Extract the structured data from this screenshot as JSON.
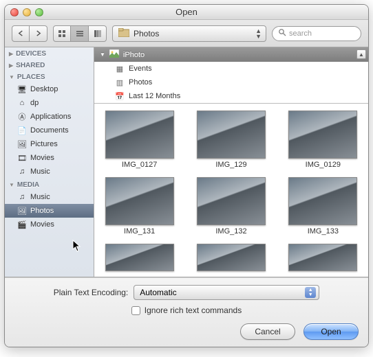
{
  "window": {
    "title": "Open"
  },
  "toolbar": {
    "path_label": "Photos",
    "search_placeholder": "search"
  },
  "sidebar": {
    "sections": {
      "devices": "DEVICES",
      "shared": "SHARED",
      "places": "PLACES",
      "media": "MEDIA"
    },
    "places": [
      {
        "label": "Desktop"
      },
      {
        "label": "dp"
      },
      {
        "label": "Applications"
      },
      {
        "label": "Documents"
      },
      {
        "label": "Pictures"
      },
      {
        "label": "Movies"
      },
      {
        "label": "Music"
      }
    ],
    "media": [
      {
        "label": "Music"
      },
      {
        "label": "Photos"
      },
      {
        "label": "Movies"
      }
    ]
  },
  "source_list": {
    "header": "iPhoto",
    "rows": [
      {
        "label": "Events"
      },
      {
        "label": "Photos"
      },
      {
        "label": "Last 12 Months"
      }
    ]
  },
  "thumbs": [
    {
      "label": "IMG_0127"
    },
    {
      "label": "IMG_129"
    },
    {
      "label": "IMG_0129"
    },
    {
      "label": "IMG_131"
    },
    {
      "label": "IMG_132"
    },
    {
      "label": "IMG_133"
    }
  ],
  "bottom": {
    "encoding_label": "Plain Text Encoding:",
    "encoding_value": "Automatic",
    "ignore_label": "Ignore rich text commands",
    "cancel": "Cancel",
    "open": "Open"
  }
}
